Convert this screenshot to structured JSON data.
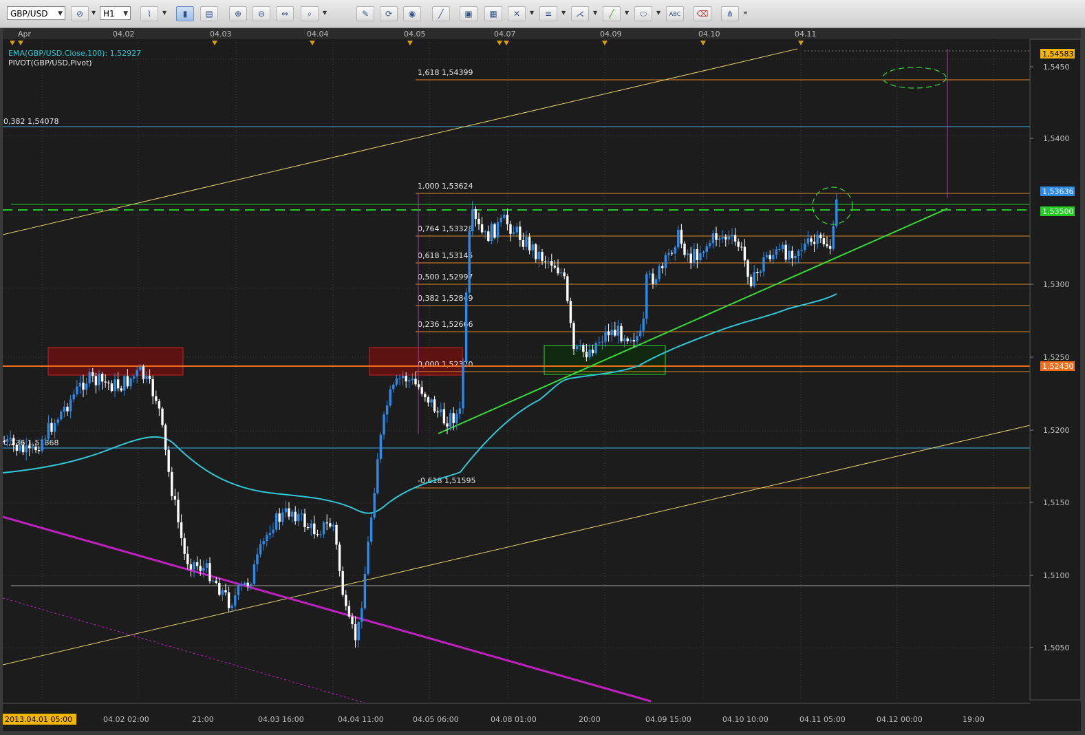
{
  "toolbar": {
    "symbol": "GBP/USD",
    "timeframe": "H1",
    "tools": [
      "indicators",
      "bar-chart",
      "candle-chart",
      "zoom-in",
      "zoom-out",
      "zoom-fit",
      "text-tool",
      "trade-tool",
      "globe",
      "ruler",
      "image",
      "template",
      "cursor-tools",
      "lines-tool",
      "fib-tools",
      "pencil-tool",
      "ellipse-tool",
      "abc-tool",
      "eraser-tool",
      "tree-tool",
      "more"
    ]
  },
  "chart": {
    "top_dates": [
      "Apr",
      "04.02",
      "04.03",
      "04.04",
      "04.05",
      "04.07",
      "04.09",
      "04.10",
      "04.11"
    ],
    "bottom_times": [
      "2013.04.01 05:00",
      "04.02 02:00",
      "21:00",
      "04.03 16:00",
      "04.04 11:00",
      "04.05 06:00",
      "04.08 01:00",
      "20:00",
      "04.09 15:00",
      "04.10 10:00",
      "04.11 05:00",
      "04.12 00:00",
      "19:00"
    ],
    "price_axis": [
      "1,5450",
      "1,5400",
      "1,5300",
      "1,5250",
      "1,5200",
      "1,5150",
      "1,5100",
      "1,5050"
    ],
    "tags": [
      {
        "label": "1,54583",
        "color": "#f2b400",
        "text": "#000000"
      },
      {
        "label": "1,53636",
        "color": "#2e8ae6",
        "text": "#ffffff"
      },
      {
        "label": "1,53500",
        "color": "#22cc22",
        "text": "#ffffff"
      },
      {
        "label": "1,52430",
        "color": "#f07020",
        "text": "#ffffff"
      }
    ],
    "indicators": {
      "ema": "EMA(GBP/USD.Close,100): 1,52927",
      "pivot": "PIVOT(GBP/USD,Pivot)"
    },
    "fib_levels": [
      {
        "label": "1,618 1,54399",
        "color": "#e0892a"
      },
      {
        "label": "1,000 1,53624",
        "color": "#e0892a"
      },
      {
        "label": "0,764 1,53328",
        "color": "#e0892a"
      },
      {
        "label": "0,618 1,53145",
        "color": "#e0892a"
      },
      {
        "label": "0,500 1,52997",
        "color": "#e0892a"
      },
      {
        "label": "0,382 1,52849",
        "color": "#e0892a"
      },
      {
        "label": "0,236 1,52666",
        "color": "#e0892a"
      },
      {
        "label": "0,000 1,52370",
        "color": "#e0892a"
      },
      {
        "label": "-0,618 1,51595",
        "color": "#e0892a"
      }
    ],
    "left_fib": [
      {
        "label": "0,382 1,54078",
        "color": "#3ab0e0"
      },
      {
        "label": "0,236 1,51868",
        "color": "#3ab0e0"
      }
    ],
    "colors": {
      "background": "#1c1c1c",
      "bull": "#2e8ae6",
      "bear": "#ffffff",
      "ema": "#2fc8d8",
      "trend": "#33dd33",
      "channel": "#e6d36a",
      "magenta": "#c020c0",
      "pivot": "#22cc22",
      "resistance": "#f07020"
    }
  }
}
